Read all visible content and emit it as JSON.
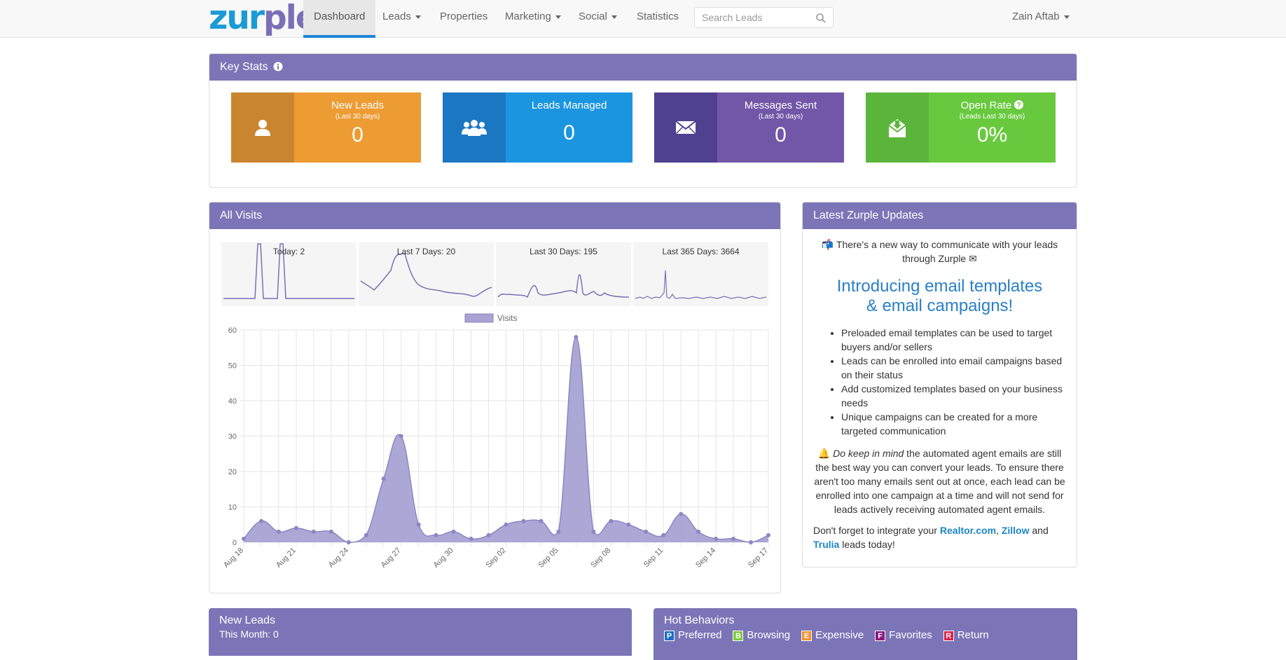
{
  "navbar": {
    "logo": {
      "part1": "zur",
      "part2": "ple"
    },
    "items": [
      {
        "label": "Dashboard",
        "active": true,
        "dropdown": false
      },
      {
        "label": "Leads",
        "dropdown": true
      },
      {
        "label": "Properties",
        "dropdown": false
      },
      {
        "label": "Marketing",
        "dropdown": true
      },
      {
        "label": "Social",
        "dropdown": true
      },
      {
        "label": "Statistics",
        "dropdown": false
      }
    ],
    "search_placeholder": "Search Leads",
    "user": "Zain Aftab"
  },
  "key_stats": {
    "title": "Key Stats",
    "tiles": [
      {
        "title": "New Leads",
        "subtitle": "(Last 30 days)",
        "value": "0",
        "icon": "user-icon",
        "color_dark": "#c98530",
        "color": "#ed9b33"
      },
      {
        "title": "Leads Managed",
        "subtitle": "",
        "value": "0",
        "icon": "users-icon",
        "color_dark": "#1c77c3",
        "color": "#1b95e0"
      },
      {
        "title": "Messages Sent",
        "subtitle": "(Last 30 days)",
        "value": "0",
        "icon": "envelope-icon",
        "color_dark": "#4f4190",
        "color": "#7256a7"
      },
      {
        "title": "Open Rate",
        "subtitle": "(Leads Last 30 days)",
        "value": "0%",
        "icon": "envelope-open-icon",
        "color_dark": "#5cb53b",
        "color": "#68c93e"
      }
    ]
  },
  "all_visits": {
    "title": "All Visits",
    "sparklines": [
      {
        "label": "Today: 2"
      },
      {
        "label": "Last 7 Days: 20"
      },
      {
        "label": "Last 30 Days: 195"
      },
      {
        "label": "Last 365 Days: 3664"
      }
    ],
    "legend": "Visits"
  },
  "chart_data": {
    "type": "area",
    "series": [
      {
        "name": "Visits",
        "values": [
          1,
          6,
          3,
          4,
          3,
          3,
          0,
          2,
          18,
          30,
          5,
          2,
          3,
          1,
          2,
          5,
          6,
          6,
          3,
          58,
          3,
          6,
          5,
          3,
          2,
          8,
          3,
          1,
          1,
          0,
          2
        ]
      }
    ],
    "x": [
      "Aug 18",
      "Aug 19",
      "Aug 20",
      "Aug 21",
      "Aug 22",
      "Aug 23",
      "Aug 24",
      "Aug 25",
      "Aug 26",
      "Aug 27",
      "Aug 28",
      "Aug 29",
      "Aug 30",
      "Aug 31",
      "Sep 01",
      "Sep 02",
      "Sep 03",
      "Sep 04",
      "Sep 05",
      "Sep 06",
      "Sep 07",
      "Sep 08",
      "Sep 09",
      "Sep 10",
      "Sep 11",
      "Sep 12",
      "Sep 13",
      "Sep 14",
      "Sep 15",
      "Sep 16",
      "Sep 17"
    ],
    "tick_labels": [
      "Aug 18",
      "Aug 21",
      "Aug 24",
      "Aug 27",
      "Aug 30",
      "Sep 02",
      "Sep 05",
      "Sep 08",
      "Sep 11",
      "Sep 14",
      "Sep 17"
    ],
    "ylim": [
      0,
      60
    ],
    "yticks": [
      0,
      10,
      20,
      30,
      40,
      50,
      60
    ],
    "legend_position": "top-center",
    "grid": true,
    "color": "#a9a2d3",
    "line_color": "#8d85c4"
  },
  "updates": {
    "title": "Latest Zurple Updates",
    "intro": "📬 There's a new way to communicate with your leads through Zurple ✉",
    "headline_1": "Introducing email templates",
    "headline_2": "& email campaigns!",
    "bullets": [
      "Preloaded email templates can be used to target buyers and/or sellers",
      "Leads can be enrolled into email campaigns based on their status",
      "Add customized templates based on your business needs",
      "Unique campaigns can be created for a more targeted communication"
    ],
    "note_emoji": "🔔",
    "note_em": "Do keep in mind",
    "note_rest": " the automated agent emails are still the best way you can convert your leads. To ensure there aren't too many emails sent out at once, each lead can be enrolled into one campaign at a time and will not send for leads actively receiving automated agent emails.",
    "integrate_pre": "Don't forget to integrate your ",
    "link_realtor": "Realtor.com",
    "comma": ", ",
    "link_zillow": "Zillow",
    "and": " and",
    "link_trulia": "Trulia",
    "integrate_post": " leads today!"
  },
  "new_leads": {
    "title": "New Leads",
    "subtitle": "This Month: 0"
  },
  "hot_behaviors": {
    "title": "Hot Behaviors",
    "items": [
      {
        "badge": "P",
        "label": "Preferred",
        "color": "#1b6fc2"
      },
      {
        "badge": "B",
        "label": "Browsing",
        "color": "#7fc93c"
      },
      {
        "badge": "E",
        "label": "Expensive",
        "color": "#f0932f"
      },
      {
        "badge": "F",
        "label": "Favorites",
        "color": "#8b1a7d"
      },
      {
        "badge": "R",
        "label": "Return",
        "color": "#d9234b"
      }
    ]
  }
}
